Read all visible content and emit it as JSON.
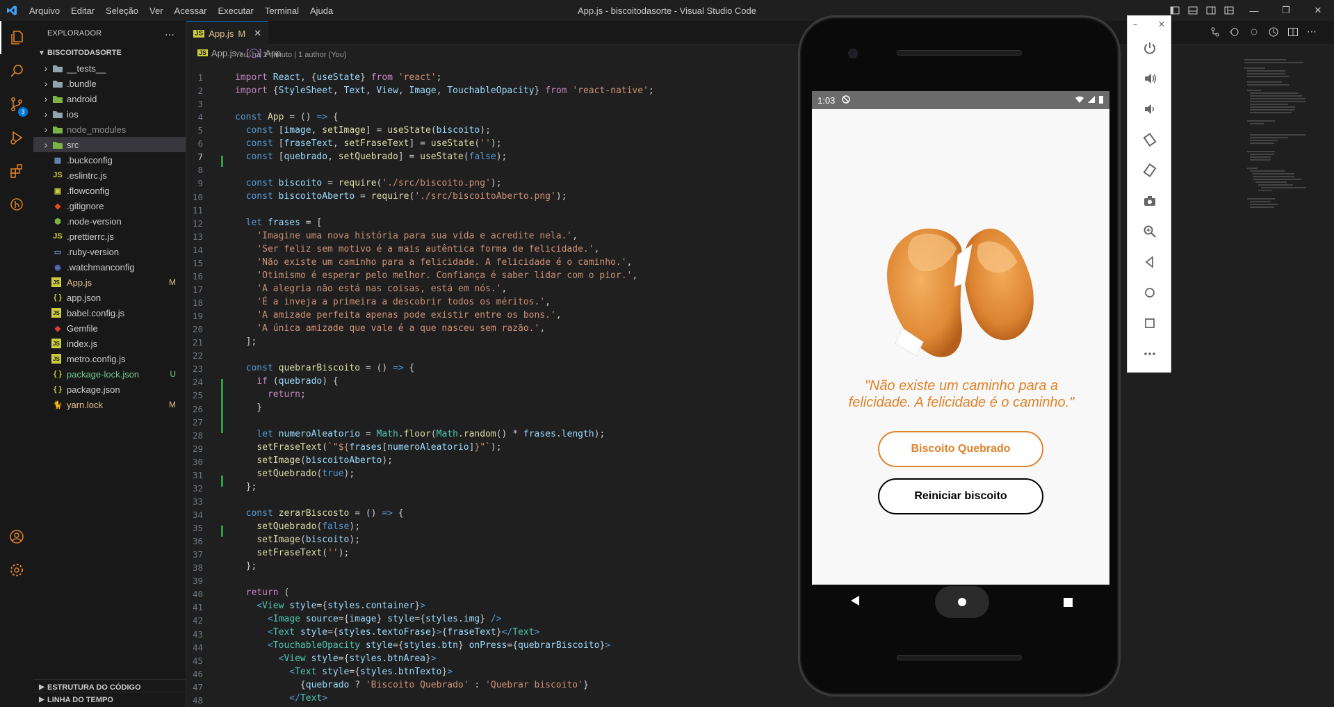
{
  "window": {
    "title": "App.js - biscoitodasorte - Visual Studio Code",
    "menu": [
      "Arquivo",
      "Editar",
      "Seleção",
      "Ver",
      "Acessar",
      "Executar",
      "Terminal",
      "Ajuda"
    ]
  },
  "activity_bar": {
    "source_control_badge": "3",
    "icons": [
      "explorer-icon",
      "search-icon",
      "source-control-icon",
      "run-debug-icon",
      "extensions-icon",
      "git-graph-icon",
      "account-icon",
      "settings-gear-icon"
    ]
  },
  "sidebar": {
    "header": "EXPLORADOR",
    "more": "...",
    "root_folder": "BISCOITODASORTE",
    "items": [
      {
        "name": "__tests__",
        "type": "folder",
        "status": ""
      },
      {
        "name": ".bundle",
        "type": "folder",
        "status": ""
      },
      {
        "name": "android",
        "type": "folder",
        "status": ""
      },
      {
        "name": "ios",
        "type": "folder",
        "status": ""
      },
      {
        "name": "node_modules",
        "type": "folder",
        "status": ""
      },
      {
        "name": "src",
        "type": "folder",
        "status": ""
      },
      {
        "name": ".buckconfig",
        "type": "file",
        "status": ""
      },
      {
        "name": ".eslintrc.js",
        "type": "file",
        "status": ""
      },
      {
        "name": ".flowconfig",
        "type": "file",
        "status": ""
      },
      {
        "name": ".gitignore",
        "type": "file",
        "status": ""
      },
      {
        "name": ".node-version",
        "type": "file",
        "status": ""
      },
      {
        "name": ".prettierrc.js",
        "type": "file",
        "status": ""
      },
      {
        "name": ".ruby-version",
        "type": "file",
        "status": ""
      },
      {
        "name": ".watchmanconfig",
        "type": "file",
        "status": ""
      },
      {
        "name": "App.js",
        "type": "file",
        "status": "M"
      },
      {
        "name": "app.json",
        "type": "file",
        "status": ""
      },
      {
        "name": "babel.config.js",
        "type": "file",
        "status": ""
      },
      {
        "name": "Gemfile",
        "type": "file",
        "status": ""
      },
      {
        "name": "index.js",
        "type": "file",
        "status": ""
      },
      {
        "name": "metro.config.js",
        "type": "file",
        "status": ""
      },
      {
        "name": "package-lock.json",
        "type": "file",
        "status": "U"
      },
      {
        "name": "package.json",
        "type": "file",
        "status": ""
      },
      {
        "name": "yarn.lock",
        "type": "file",
        "status": "M"
      }
    ],
    "outline_section": "ESTRUTURA DO CÓDIGO",
    "timeline_section": "LINHA DO TEMPO"
  },
  "editor": {
    "tab_label": "App.js",
    "tab_status": "M",
    "breadcrumb": [
      "App.js",
      "App"
    ],
    "codelens": "You, há 1 minuto | 1 author (You)",
    "line_numbers": [
      "1",
      "2",
      "3",
      "4",
      "5",
      "6",
      "7",
      "8",
      "9",
      "10",
      "11",
      "12",
      "13",
      "14",
      "15",
      "16",
      "17",
      "18",
      "19",
      "20",
      "21",
      "22",
      "23",
      "24",
      "25",
      "26",
      "27",
      "28",
      "29",
      "30",
      "31",
      "32",
      "33",
      "34",
      "35",
      "36",
      "37",
      "38",
      "39",
      "40",
      "41",
      "42",
      "43",
      "44",
      "45",
      "46",
      "47",
      "48"
    ]
  },
  "phone": {
    "time": "1:03",
    "phrase": "\"Não existe um caminho para a felicidade. A felicidade é o caminho.\"",
    "btn_broken": "Biscoito Quebrado",
    "btn_reset": "Reiniciar biscoito"
  },
  "emulator_toolbar": {
    "icons": [
      "power-icon",
      "volume-up-icon",
      "volume-down-icon",
      "rotate-left-icon",
      "rotate-right-icon",
      "camera-icon",
      "zoom-icon",
      "back-icon",
      "home-icon",
      "overview-icon",
      "more-icon"
    ]
  }
}
